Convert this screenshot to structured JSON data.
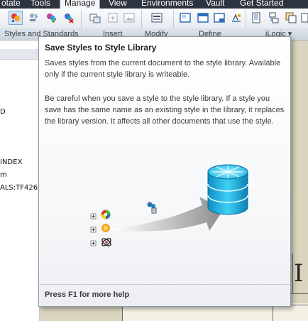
{
  "menu_tabs": [
    {
      "label": "otate",
      "active": false
    },
    {
      "label": "Tools",
      "active": false
    },
    {
      "label": "Manage",
      "active": true
    },
    {
      "label": "View",
      "active": false
    },
    {
      "label": "Environments",
      "active": false
    },
    {
      "label": "Vault",
      "active": false
    },
    {
      "label": "Get Started",
      "active": false
    }
  ],
  "ribbon_groups": [
    "Styles and Standards",
    "Insert",
    "Modify",
    "Define",
    "iLogic ▾"
  ],
  "left_panel": {
    "lines": [
      "D",
      "INDEX",
      "m",
      "ALS:TF426:"
    ]
  },
  "canvas": {
    "large_letter": "I"
  },
  "tooltip": {
    "title": "Save Styles to Style Library",
    "summary": "Saves styles from the current document to the style library. Available only if the current style library is writeable.",
    "details": "Be careful when you save a style to the style library. If a style you save has the same name as an existing style in the library, it replaces the library version. It affects all other documents that use the style.",
    "footer": "Press F1 for more help"
  },
  "colors": {
    "menubar": "#2d3440",
    "tooltip_border": "#8f98a4",
    "database_cyan": "#19b6e6",
    "arrow_gray": "#8c8c8c",
    "canvas": "#d9d4bd"
  }
}
